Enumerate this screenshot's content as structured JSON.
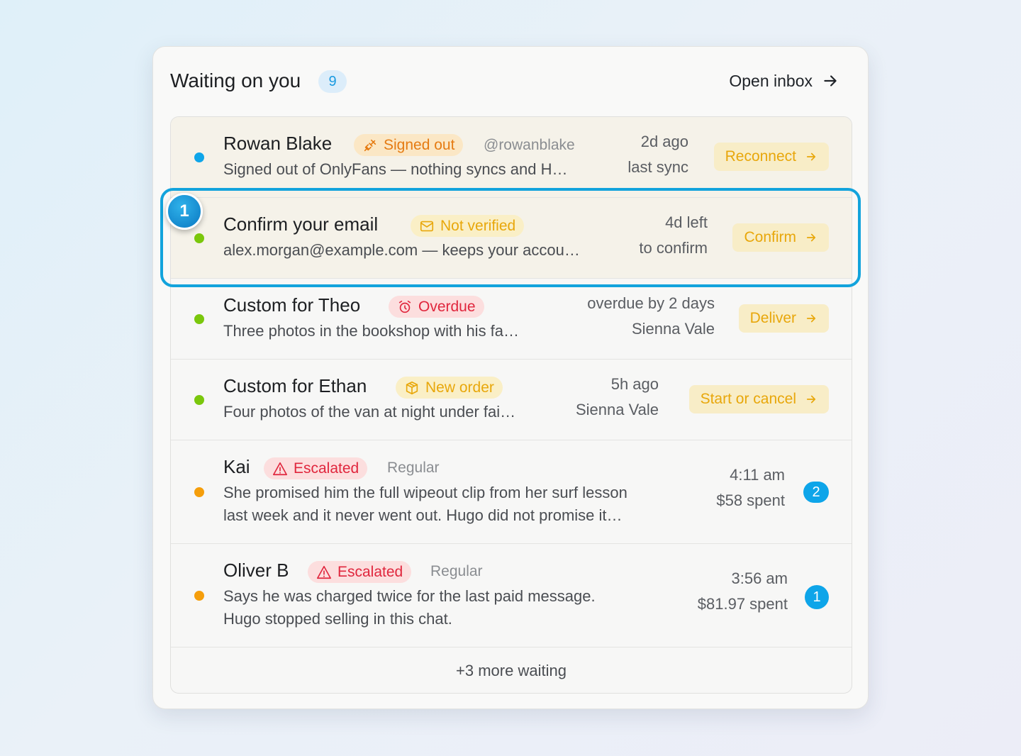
{
  "header": {
    "title": "Waiting on you",
    "count": "9",
    "open_inbox": "Open inbox"
  },
  "colors": {
    "blue": "#0ea5e9",
    "green": "#7ac70c",
    "orange_dot": "#f59e0b",
    "highlight": "#12a3dc"
  },
  "rows": [
    {
      "dot": "blue",
      "name": "Rowan Blake",
      "tag": "Signed out",
      "tag_icon": "plug-icon",
      "handle": "@rowanblake",
      "preview": "Signed out of OnlyFans — nothing syncs and H…",
      "right_top": "2d ago",
      "right_bot": "last sync",
      "action": "Reconnect"
    },
    {
      "dot": "green",
      "name": "Confirm your email",
      "tag": "Not verified",
      "tag_icon": "mail-icon",
      "preview": "alex.morgan@example.com — keeps your accou…",
      "right_top": "4d left",
      "right_bot": "to confirm",
      "action": "Confirm"
    },
    {
      "dot": "green",
      "name": "Custom for Theo",
      "tag": "Overdue",
      "tag_icon": "alarm-clock-icon",
      "preview": "Three photos in the bookshop with his fa…",
      "right_top": "overdue by 2 days",
      "right_bot": "Sienna Vale",
      "action": "Deliver"
    },
    {
      "dot": "green",
      "name": "Custom for Ethan",
      "tag": "New order",
      "tag_icon": "package-icon",
      "preview": "Four photos of the van at night under fai…",
      "right_top": "5h ago",
      "right_bot": "Sienna Vale",
      "action": "Start or cancel"
    },
    {
      "dot": "orange",
      "name": "Kai",
      "tag": "Escalated",
      "tag_icon": "warning-icon",
      "segment": "Regular",
      "preview_line1": "She promised him the full wipeout clip from her surf lesson",
      "preview_line2": "last week and it never went out. Hugo did not promise it…",
      "right_top": "4:11 am",
      "right_bot": "$58 spent",
      "unread": "2"
    },
    {
      "dot": "orange",
      "name": "Oliver B",
      "tag": "Escalated",
      "tag_icon": "warning-icon",
      "segment": "Regular",
      "preview_line1": "Says he was charged twice for the last paid message.",
      "preview_line2": "Hugo stopped selling in this chat.",
      "right_top": "3:56 am",
      "right_bot": "$81.97 spent",
      "unread": "1"
    }
  ],
  "more": "+3 more waiting",
  "step_badge": "1"
}
